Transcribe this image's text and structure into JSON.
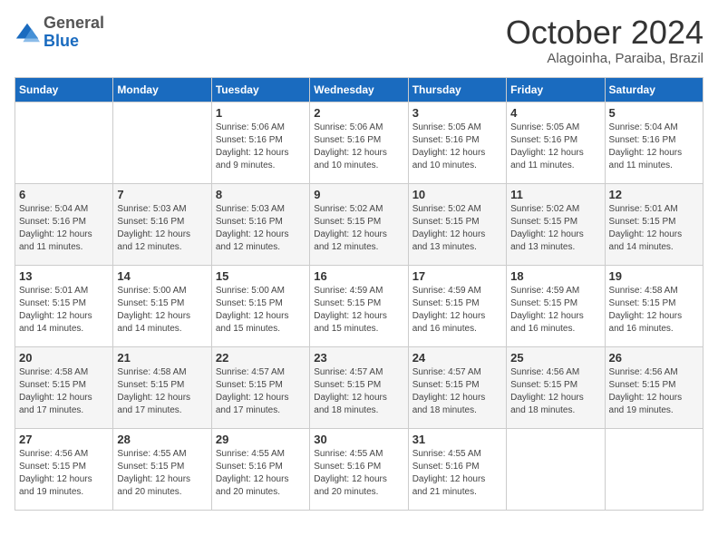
{
  "header": {
    "logo_general": "General",
    "logo_blue": "Blue",
    "month_title": "October 2024",
    "location": "Alagoinha, Paraiba, Brazil"
  },
  "columns": [
    "Sunday",
    "Monday",
    "Tuesday",
    "Wednesday",
    "Thursday",
    "Friday",
    "Saturday"
  ],
  "weeks": [
    [
      {
        "day": "",
        "sunrise": "",
        "sunset": "",
        "daylight": ""
      },
      {
        "day": "",
        "sunrise": "",
        "sunset": "",
        "daylight": ""
      },
      {
        "day": "1",
        "sunrise": "Sunrise: 5:06 AM",
        "sunset": "Sunset: 5:16 PM",
        "daylight": "Daylight: 12 hours and 9 minutes."
      },
      {
        "day": "2",
        "sunrise": "Sunrise: 5:06 AM",
        "sunset": "Sunset: 5:16 PM",
        "daylight": "Daylight: 12 hours and 10 minutes."
      },
      {
        "day": "3",
        "sunrise": "Sunrise: 5:05 AM",
        "sunset": "Sunset: 5:16 PM",
        "daylight": "Daylight: 12 hours and 10 minutes."
      },
      {
        "day": "4",
        "sunrise": "Sunrise: 5:05 AM",
        "sunset": "Sunset: 5:16 PM",
        "daylight": "Daylight: 12 hours and 11 minutes."
      },
      {
        "day": "5",
        "sunrise": "Sunrise: 5:04 AM",
        "sunset": "Sunset: 5:16 PM",
        "daylight": "Daylight: 12 hours and 11 minutes."
      }
    ],
    [
      {
        "day": "6",
        "sunrise": "Sunrise: 5:04 AM",
        "sunset": "Sunset: 5:16 PM",
        "daylight": "Daylight: 12 hours and 11 minutes."
      },
      {
        "day": "7",
        "sunrise": "Sunrise: 5:03 AM",
        "sunset": "Sunset: 5:16 PM",
        "daylight": "Daylight: 12 hours and 12 minutes."
      },
      {
        "day": "8",
        "sunrise": "Sunrise: 5:03 AM",
        "sunset": "Sunset: 5:16 PM",
        "daylight": "Daylight: 12 hours and 12 minutes."
      },
      {
        "day": "9",
        "sunrise": "Sunrise: 5:02 AM",
        "sunset": "Sunset: 5:15 PM",
        "daylight": "Daylight: 12 hours and 12 minutes."
      },
      {
        "day": "10",
        "sunrise": "Sunrise: 5:02 AM",
        "sunset": "Sunset: 5:15 PM",
        "daylight": "Daylight: 12 hours and 13 minutes."
      },
      {
        "day": "11",
        "sunrise": "Sunrise: 5:02 AM",
        "sunset": "Sunset: 5:15 PM",
        "daylight": "Daylight: 12 hours and 13 minutes."
      },
      {
        "day": "12",
        "sunrise": "Sunrise: 5:01 AM",
        "sunset": "Sunset: 5:15 PM",
        "daylight": "Daylight: 12 hours and 14 minutes."
      }
    ],
    [
      {
        "day": "13",
        "sunrise": "Sunrise: 5:01 AM",
        "sunset": "Sunset: 5:15 PM",
        "daylight": "Daylight: 12 hours and 14 minutes."
      },
      {
        "day": "14",
        "sunrise": "Sunrise: 5:00 AM",
        "sunset": "Sunset: 5:15 PM",
        "daylight": "Daylight: 12 hours and 14 minutes."
      },
      {
        "day": "15",
        "sunrise": "Sunrise: 5:00 AM",
        "sunset": "Sunset: 5:15 PM",
        "daylight": "Daylight: 12 hours and 15 minutes."
      },
      {
        "day": "16",
        "sunrise": "Sunrise: 4:59 AM",
        "sunset": "Sunset: 5:15 PM",
        "daylight": "Daylight: 12 hours and 15 minutes."
      },
      {
        "day": "17",
        "sunrise": "Sunrise: 4:59 AM",
        "sunset": "Sunset: 5:15 PM",
        "daylight": "Daylight: 12 hours and 16 minutes."
      },
      {
        "day": "18",
        "sunrise": "Sunrise: 4:59 AM",
        "sunset": "Sunset: 5:15 PM",
        "daylight": "Daylight: 12 hours and 16 minutes."
      },
      {
        "day": "19",
        "sunrise": "Sunrise: 4:58 AM",
        "sunset": "Sunset: 5:15 PM",
        "daylight": "Daylight: 12 hours and 16 minutes."
      }
    ],
    [
      {
        "day": "20",
        "sunrise": "Sunrise: 4:58 AM",
        "sunset": "Sunset: 5:15 PM",
        "daylight": "Daylight: 12 hours and 17 minutes."
      },
      {
        "day": "21",
        "sunrise": "Sunrise: 4:58 AM",
        "sunset": "Sunset: 5:15 PM",
        "daylight": "Daylight: 12 hours and 17 minutes."
      },
      {
        "day": "22",
        "sunrise": "Sunrise: 4:57 AM",
        "sunset": "Sunset: 5:15 PM",
        "daylight": "Daylight: 12 hours and 17 minutes."
      },
      {
        "day": "23",
        "sunrise": "Sunrise: 4:57 AM",
        "sunset": "Sunset: 5:15 PM",
        "daylight": "Daylight: 12 hours and 18 minutes."
      },
      {
        "day": "24",
        "sunrise": "Sunrise: 4:57 AM",
        "sunset": "Sunset: 5:15 PM",
        "daylight": "Daylight: 12 hours and 18 minutes."
      },
      {
        "day": "25",
        "sunrise": "Sunrise: 4:56 AM",
        "sunset": "Sunset: 5:15 PM",
        "daylight": "Daylight: 12 hours and 18 minutes."
      },
      {
        "day": "26",
        "sunrise": "Sunrise: 4:56 AM",
        "sunset": "Sunset: 5:15 PM",
        "daylight": "Daylight: 12 hours and 19 minutes."
      }
    ],
    [
      {
        "day": "27",
        "sunrise": "Sunrise: 4:56 AM",
        "sunset": "Sunset: 5:15 PM",
        "daylight": "Daylight: 12 hours and 19 minutes."
      },
      {
        "day": "28",
        "sunrise": "Sunrise: 4:55 AM",
        "sunset": "Sunset: 5:15 PM",
        "daylight": "Daylight: 12 hours and 20 minutes."
      },
      {
        "day": "29",
        "sunrise": "Sunrise: 4:55 AM",
        "sunset": "Sunset: 5:16 PM",
        "daylight": "Daylight: 12 hours and 20 minutes."
      },
      {
        "day": "30",
        "sunrise": "Sunrise: 4:55 AM",
        "sunset": "Sunset: 5:16 PM",
        "daylight": "Daylight: 12 hours and 20 minutes."
      },
      {
        "day": "31",
        "sunrise": "Sunrise: 4:55 AM",
        "sunset": "Sunset: 5:16 PM",
        "daylight": "Daylight: 12 hours and 21 minutes."
      },
      {
        "day": "",
        "sunrise": "",
        "sunset": "",
        "daylight": ""
      },
      {
        "day": "",
        "sunrise": "",
        "sunset": "",
        "daylight": ""
      }
    ]
  ]
}
